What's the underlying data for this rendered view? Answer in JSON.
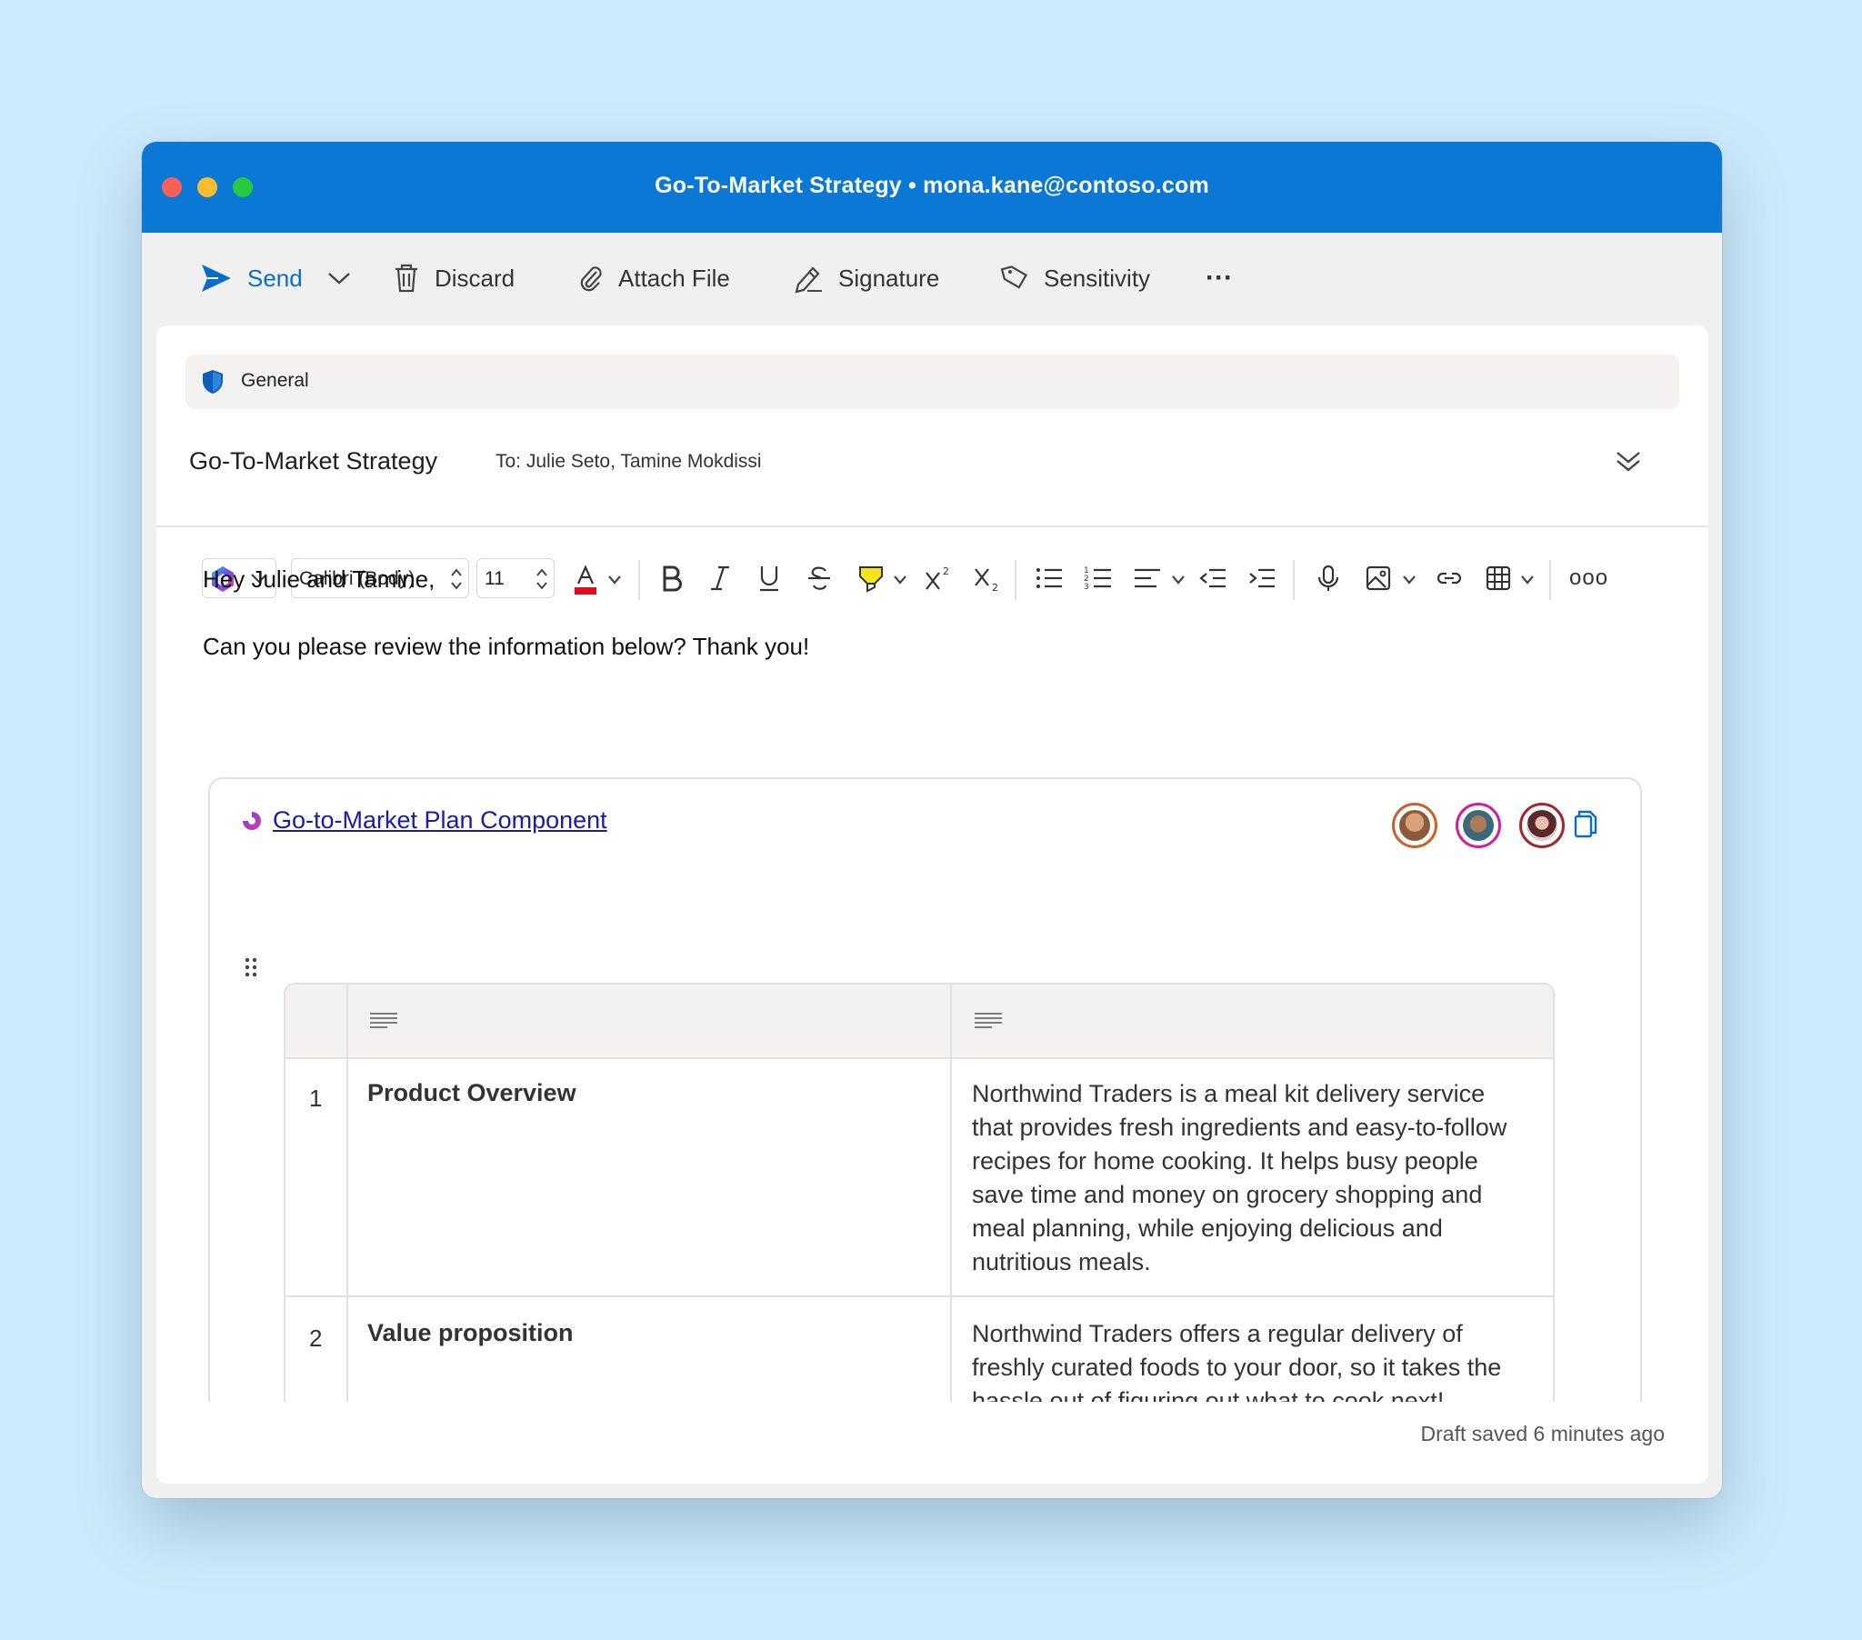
{
  "window": {
    "title": "Go-To-Market Strategy • mona.kane@contoso.com"
  },
  "toolbar": {
    "send_label": "Send",
    "discard_label": "Discard",
    "attach_label": "Attach File",
    "signature_label": "Signature",
    "sensitivity_label": "Sensitivity",
    "more_label": "···"
  },
  "sensitivity": {
    "label": "General"
  },
  "header": {
    "subject": "Go-To-Market Strategy",
    "to": "To: Julie Seto, Tamine Mokdissi"
  },
  "format": {
    "font": "Calibri (Body)",
    "size": "11",
    "more_label": "ooo"
  },
  "body": {
    "greeting": "Hey Julie and Tamine,",
    "line": "Can you please review the information below? Thank you!"
  },
  "loop": {
    "link": "Go-to-Market Plan Component",
    "rows": [
      {
        "num": "1",
        "label": "Product Overview",
        "desc": "Northwind Traders is a meal kit delivery service that provides fresh ingredients and easy-to-follow recipes for home cooking. It helps busy people save time and money on grocery shopping and meal planning, while enjoying delicious and nutritious meals."
      },
      {
        "num": "2",
        "label": "Value proposition",
        "desc": "Northwind Traders offers a regular delivery of freshly curated foods to your door, so it takes the hassle out of figuring out what to cook next!"
      }
    ]
  },
  "status": {
    "draft": "Draft saved 6 minutes ago"
  },
  "colors": {
    "titlebar": "#0a78d4",
    "accent": "#0a6cc9",
    "link": "#1b1ba8",
    "avatar_1_ring": "#c9622a",
    "avatar_2_ring": "#d21f9a",
    "avatar_3_ring": "#a4262c"
  }
}
